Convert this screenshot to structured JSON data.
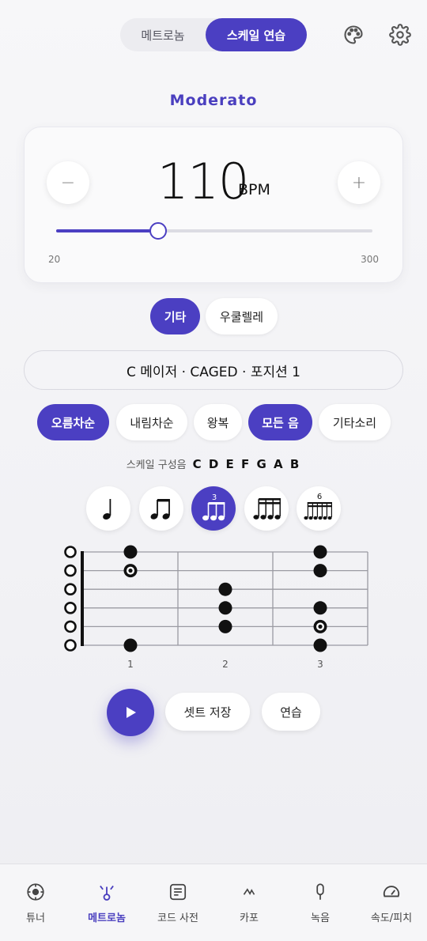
{
  "topbar": {
    "tabs": [
      {
        "label": "메트로놈",
        "active": false
      },
      {
        "label": "스케일 연습",
        "active": true
      }
    ],
    "icons": [
      "palette-icon",
      "gear-icon"
    ]
  },
  "tempo": {
    "name": "Moderato",
    "bpm": "110",
    "unit": "BPM",
    "minus": "−",
    "plus": "+",
    "min_label": "20",
    "max_label": "300",
    "slider_min": 20,
    "slider_max": 300,
    "slider_value": 110
  },
  "instrument": {
    "options": [
      {
        "label": "기타",
        "active": true
      },
      {
        "label": "우쿨렐레",
        "active": false
      }
    ]
  },
  "scale": {
    "title": "C 메이저 · CAGED · 포지션 1",
    "modes": [
      {
        "label": "오름차순",
        "active": true
      },
      {
        "label": "내림차순",
        "active": false
      },
      {
        "label": "왕복",
        "active": false
      },
      {
        "label": "모든 음",
        "active": true
      },
      {
        "label": "기타소리",
        "active": false
      }
    ],
    "notes_label": "스케일 구성음",
    "notes_value": "C D E F G A B"
  },
  "rhythms": [
    {
      "name": "quarter-note-icon",
      "active": false,
      "tuplet": ""
    },
    {
      "name": "eighth-notes-icon",
      "active": false,
      "tuplet": ""
    },
    {
      "name": "triplet-icon",
      "active": true,
      "tuplet": "3"
    },
    {
      "name": "sixteenth-notes-icon",
      "active": false,
      "tuplet": ""
    },
    {
      "name": "sextuplet-icon",
      "active": false,
      "tuplet": "6"
    }
  ],
  "fretboard": {
    "fret_numbers": [
      "1",
      "2",
      "3"
    ],
    "strings": 6,
    "open_strings": [
      1,
      2,
      3,
      4,
      5,
      6
    ],
    "dots": [
      {
        "string": 1,
        "fret": 1,
        "root": false
      },
      {
        "string": 2,
        "fret": 1,
        "root": true
      },
      {
        "string": 6,
        "fret": 1,
        "root": false
      },
      {
        "string": 3,
        "fret": 2,
        "root": false
      },
      {
        "string": 4,
        "fret": 2,
        "root": false
      },
      {
        "string": 5,
        "fret": 2,
        "root": false
      },
      {
        "string": 1,
        "fret": 3,
        "root": false
      },
      {
        "string": 2,
        "fret": 3,
        "root": false
      },
      {
        "string": 4,
        "fret": 3,
        "root": false
      },
      {
        "string": 5,
        "fret": 3,
        "root": true
      },
      {
        "string": 6,
        "fret": 3,
        "root": false
      }
    ]
  },
  "actions": {
    "save_set": "셋트 저장",
    "practice": "연습"
  },
  "nav": [
    {
      "label": "튜너",
      "icon": "tuner-icon",
      "active": false
    },
    {
      "label": "메트로놈",
      "icon": "metronome-icon",
      "active": true
    },
    {
      "label": "코드 사전",
      "icon": "chord-dictionary-icon",
      "active": false
    },
    {
      "label": "카포",
      "icon": "capo-icon",
      "active": false
    },
    {
      "label": "녹음",
      "icon": "microphone-icon",
      "active": false
    },
    {
      "label": "속도/피치",
      "icon": "speedometer-icon",
      "active": false
    }
  ],
  "colors": {
    "accent": "#4b3fc2",
    "background": "#f3f3f6"
  }
}
